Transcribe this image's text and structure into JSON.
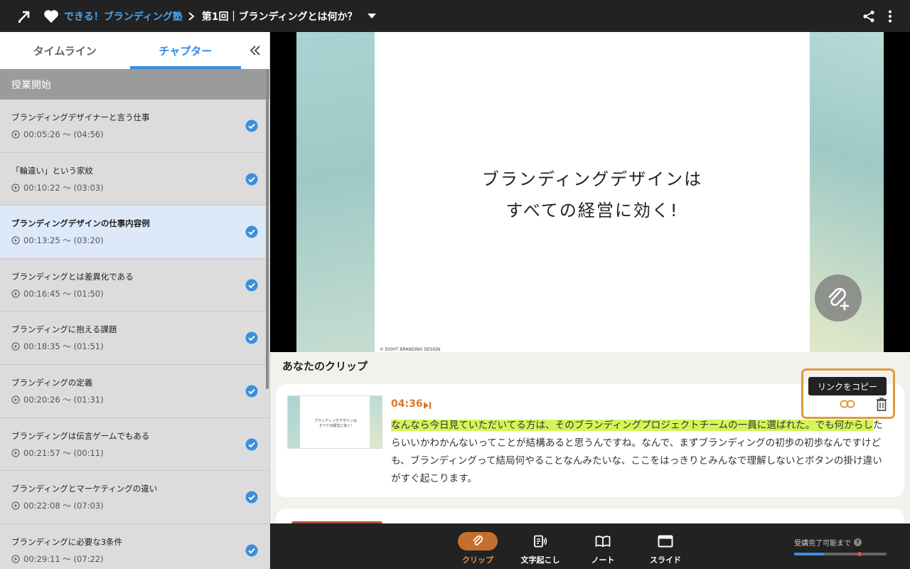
{
  "header": {
    "school_name": "できる！ブランディング塾",
    "lesson_title": "第1回｜ブランディングとは何か？"
  },
  "sidebar": {
    "tabs": [
      {
        "label": "タイムライン"
      },
      {
        "label": "チャプター"
      }
    ],
    "section_label": "授業開始",
    "chapters": [
      {
        "title": "ブランディングデザイナーと言う仕事",
        "time": "00:05:26 〜 (04:56)",
        "done": true
      },
      {
        "title": "「輪違い」という家紋",
        "time": "00:10:22 〜 (03:03)",
        "done": true
      },
      {
        "title": "ブランディングデザインの仕事内容例",
        "time": "00:13:25 〜 (03:20)",
        "done": true
      },
      {
        "title": "ブランディングとは差異化である",
        "time": "00:16:45 〜 (01:50)",
        "done": true
      },
      {
        "title": "ブランディングに抱える課題",
        "time": "00:18:35 〜 (01:51)",
        "done": true
      },
      {
        "title": "ブランディングの定義",
        "time": "00:20:26 〜 (01:31)",
        "done": true
      },
      {
        "title": "ブランディングは伝言ゲームでもある",
        "time": "00:21:57 〜 (00:11)",
        "done": true
      },
      {
        "title": "ブランディングとマーケティングの違い",
        "time": "00:22:08 〜 (07:03)",
        "done": true
      },
      {
        "title": "ブランディングに必要な3条件",
        "time": "00:29:11 〜 (07:22)",
        "done": true
      }
    ]
  },
  "video": {
    "slide_line1": "ブランディングデザインは",
    "slide_line2": "すべての経営に効く!",
    "copyright": "© EIGHT BRANDING DESIGN"
  },
  "clips": {
    "section_title": "あなたのクリップ",
    "items": [
      {
        "time": "04:36",
        "thumb_line1": "ブランディングデザインは",
        "thumb_line2": "すべての経営に効く!",
        "text_highlight": "なんなら今日見ていただいてる方は、そのブランディングプロジェクトチームの一員に選ばれた。でも何からし",
        "text_rest": "たらいいかわかんないってことが結構あると思うんですね。なんで、まずブランディングの初歩の初歩なんですけども、ブランディングって結局何やることなんみたいな、ここをはっきりとみんなで理解しないとボタンの掛け違いがすぐ起こります。"
      }
    ],
    "tooltip": "リンクをコピー"
  },
  "bottombar": {
    "items": [
      {
        "label": "クリップ"
      },
      {
        "label": "文字起こし"
      },
      {
        "label": "ノート"
      },
      {
        "label": "スライド"
      }
    ],
    "progress_label": "受講完了可能まで",
    "progress_help": "?",
    "progress_fraction": 0.32,
    "progress_marker": 0.69
  },
  "colors": {
    "accent_blue": "#3b8fde",
    "accent_orange": "#d8782c",
    "highlight": "#d4f55a"
  }
}
